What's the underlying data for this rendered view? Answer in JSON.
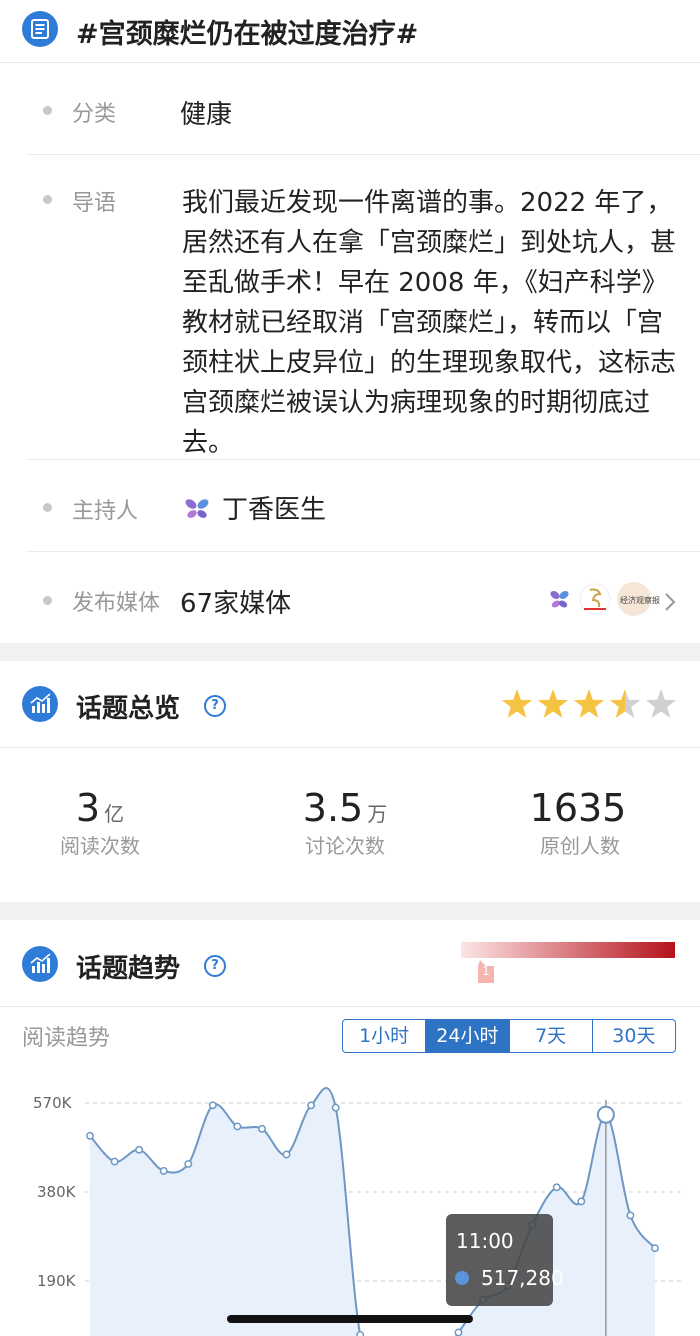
{
  "header": {
    "title": "#宫颈糜烂仍在被过度治疗#"
  },
  "info": {
    "category": {
      "label": "分类",
      "value": "健康"
    },
    "intro": {
      "label": "导语",
      "text": "我们最近发现一件离谱的事。2022 年了，居然还有人在拿「宫颈糜烂」到处坑人，甚至乱做手术！早在 2008 年，《妇产科学》教材就已经取消「宫颈糜烂」，转而以「宫颈柱状上皮异位」的生理现象取代，这标志宫颈糜烂被误认为病理现象的时期彻底过去。"
    },
    "host": {
      "label": "主持人",
      "value": "丁香医生"
    },
    "media": {
      "label": "发布媒体",
      "value": "67家媒体",
      "logo_text": "经济观察报"
    }
  },
  "overview": {
    "title": "话题总览",
    "rating": 3.5,
    "stats": [
      {
        "num": "3",
        "unit": "亿",
        "label": "阅读次数"
      },
      {
        "num": "3.5",
        "unit": "万",
        "label": "讨论次数"
      },
      {
        "num": "1635",
        "unit": "",
        "label": "原创人数"
      }
    ]
  },
  "trend": {
    "title": "话题趋势",
    "heat_level": "1",
    "subtitle": "阅读趋势",
    "tabs": [
      "1小时",
      "24小时",
      "7天",
      "30天"
    ],
    "active_tab": "24小时",
    "tooltip": {
      "time": "11:00",
      "value": "517,280"
    }
  },
  "colors": {
    "accent": "#2f74c4",
    "star": "#f5c342",
    "line": "#6f97c4",
    "fill": "#e8f0fb"
  },
  "chart_data": {
    "type": "area",
    "y_ticks": [
      "570K",
      "380K",
      "190K"
    ],
    "ylim": [
      0,
      570000
    ],
    "values": [
      500000,
      445000,
      470000,
      425000,
      440000,
      565000,
      520000,
      515000,
      460000,
      565000,
      560000,
      75000,
      0,
      0,
      0,
      80000,
      150000,
      180000,
      310000,
      390000,
      360000,
      545000,
      330000,
      260000
    ],
    "highlight_index": 21
  }
}
